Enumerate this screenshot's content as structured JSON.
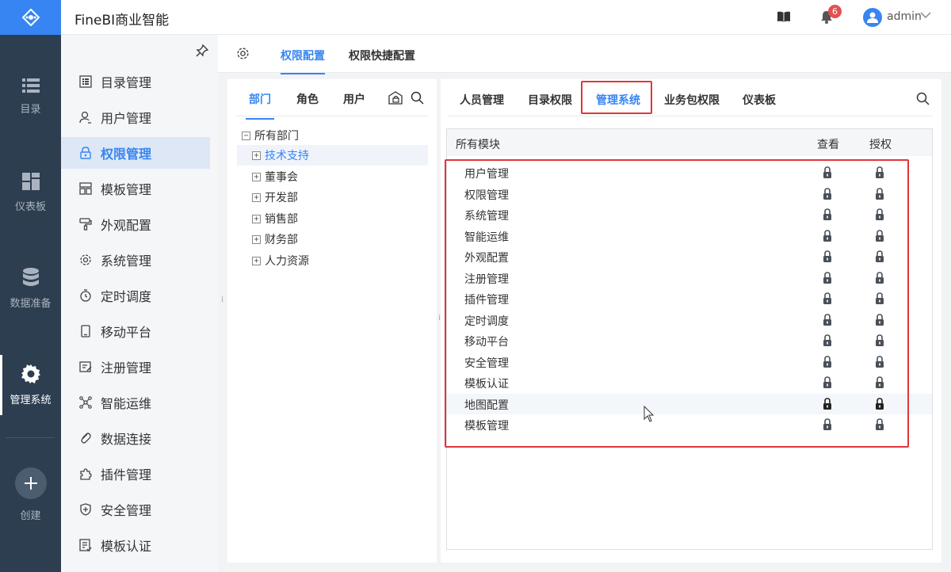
{
  "app": {
    "title": "FineBI商业智能"
  },
  "rail": {
    "items": [
      {
        "label": "目录",
        "icon": "list-icon"
      },
      {
        "label": "仪表板",
        "icon": "dashboard-icon"
      },
      {
        "label": "数据准备",
        "icon": "database-icon"
      },
      {
        "label": "管理系统",
        "icon": "gear-icon",
        "active": true
      }
    ],
    "create_label": "创建"
  },
  "header": {
    "notification_count": "6",
    "username": "admin"
  },
  "menu": {
    "items": [
      {
        "label": "目录管理",
        "icon": "catalog-icon"
      },
      {
        "label": "用户管理",
        "icon": "user-icon"
      },
      {
        "label": "权限管理",
        "icon": "lock-icon",
        "active": true
      },
      {
        "label": "模板管理",
        "icon": "template-icon"
      },
      {
        "label": "外观配置",
        "icon": "paint-icon"
      },
      {
        "label": "系统管理",
        "icon": "gear-icon"
      },
      {
        "label": "定时调度",
        "icon": "timer-icon"
      },
      {
        "label": "移动平台",
        "icon": "mobile-icon"
      },
      {
        "label": "注册管理",
        "icon": "register-icon"
      },
      {
        "label": "智能运维",
        "icon": "ops-icon"
      },
      {
        "label": "数据连接",
        "icon": "link-icon"
      },
      {
        "label": "插件管理",
        "icon": "plugin-icon"
      },
      {
        "label": "安全管理",
        "icon": "shield-icon"
      },
      {
        "label": "模板认证",
        "icon": "certify-icon"
      }
    ]
  },
  "tabs": {
    "config": "权限配置",
    "quick": "权限快捷配置"
  },
  "tree": {
    "tabs": {
      "dept": "部门",
      "role": "角色",
      "user": "用户"
    },
    "root": "所有部门",
    "children": [
      "技术支持",
      "董事会",
      "开发部",
      "销售部",
      "财务部",
      "人力资源"
    ]
  },
  "perm": {
    "tabs": [
      "人员管理",
      "目录权限",
      "管理系统",
      "业务包权限",
      "仪表板"
    ],
    "active_tab": "管理系统",
    "table": {
      "headers": {
        "module": "所有模块",
        "view": "查看",
        "grant": "授权"
      },
      "rows": [
        "用户管理",
        "权限管理",
        "系统管理",
        "智能运维",
        "外观配置",
        "注册管理",
        "插件管理",
        "定时调度",
        "移动平台",
        "安全管理",
        "模板认证",
        "地图配置",
        "模板管理"
      ]
    }
  },
  "colors": {
    "accent": "#3685f2",
    "highlight": "#e2353b",
    "rail": "#2c3e50"
  }
}
